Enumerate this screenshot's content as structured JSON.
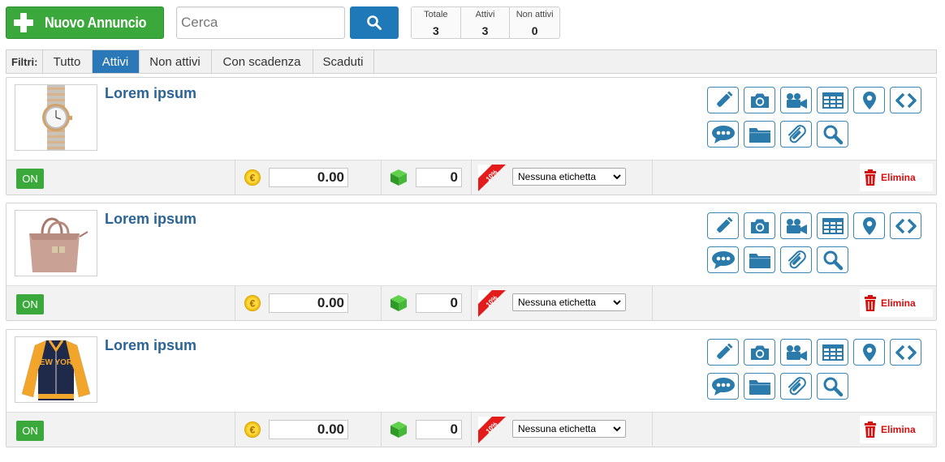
{
  "toolbar": {
    "new_label": "Nuovo Annuncio",
    "search_placeholder": "Cerca",
    "counters": [
      {
        "label": "Totale",
        "value": "3"
      },
      {
        "label": "Attivi",
        "value": "3"
      },
      {
        "label": "Non attivi",
        "value": "0"
      }
    ]
  },
  "filters": {
    "label": "Filtri:",
    "tabs": [
      {
        "label": "Tutto",
        "active": false
      },
      {
        "label": "Attivi",
        "active": true
      },
      {
        "label": "Non attivi",
        "active": false
      },
      {
        "label": "Con scadenza",
        "active": false
      },
      {
        "label": "Scaduti",
        "active": false
      }
    ]
  },
  "colors": {
    "green": "#3aa83a",
    "blue": "#1f78b8",
    "title_blue": "#2a6496",
    "icon_blue": "#2a7bab",
    "delete_red": "#d60f0f"
  },
  "action_icons": [
    "edit-icon",
    "camera-icon",
    "video-icon",
    "table-icon",
    "map-pin-icon",
    "code-icon",
    "comments-icon",
    "folder-icon",
    "paperclip-icon",
    "magnify-icon"
  ],
  "items": [
    {
      "title": "Lorem ipsum",
      "image": "watch",
      "status": "ON",
      "price": "0.00",
      "quantity": "0",
      "discount": "10%",
      "tag": "Nessuna etichetta",
      "delete_label": "Elimina"
    },
    {
      "title": "Lorem ipsum",
      "image": "handbag",
      "status": "ON",
      "price": "0.00",
      "quantity": "0",
      "discount": "10%",
      "tag": "Nessuna etichetta",
      "delete_label": "Elimina"
    },
    {
      "title": "Lorem ipsum",
      "image": "jacket",
      "status": "ON",
      "price": "0.00",
      "quantity": "0",
      "discount": "10%",
      "tag": "Nessuna etichetta",
      "delete_label": "Elimina"
    }
  ]
}
